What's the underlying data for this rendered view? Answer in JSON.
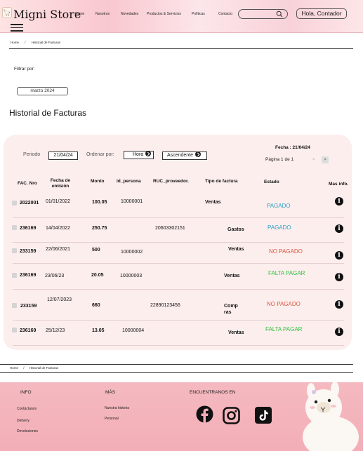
{
  "header": {
    "brand": "Migni Store",
    "nav": [
      "Home",
      "Nosotros",
      "Novedades",
      "Productos & Servicios",
      "Políticas",
      "Contacto"
    ],
    "search_placeholder": "",
    "account_label": "Hola, Contador"
  },
  "breadcrumb": {
    "home": "Home",
    "separator": "/",
    "current": "Historial de Facturas"
  },
  "filter": {
    "label": "Filtrar por:",
    "month": "marzo 2024"
  },
  "page_title": "Historial de Facturas",
  "controls": {
    "period_label": "Periodo",
    "period_value": "21/04/24",
    "order_label": "Ordenar por:",
    "order_value": "Hora",
    "direction_value": "Ascendente",
    "date_label": "Fecha : 21/04/24",
    "page_label": "Página 1 de 1",
    "prev": "<",
    "next": ">"
  },
  "table": {
    "columns": {
      "fac": "FAC. Nro",
      "fecha": "Fecha de emisión",
      "monto": "Monto",
      "persona": "id_persona",
      "ruc": "RUC_proveedor.",
      "tipo": "Tipo de factura",
      "estado": "Estado",
      "info": "Mas info."
    },
    "rows": [
      {
        "fac": "2022001",
        "fecha": "01/01/2022",
        "monto": "100.05",
        "persona": "10000001",
        "ruc": "",
        "tipo": "Ventas",
        "estado": "PAGADO"
      },
      {
        "fac": "236169",
        "fecha": "14/04/2022",
        "monto": "250.75",
        "persona": "",
        "ruc": "20603302151",
        "tipo": "Gastos",
        "estado": "PAGADO"
      },
      {
        "fac": "233159",
        "fecha": "22/06/2021",
        "monto": "500",
        "persona": "10000002",
        "ruc": "",
        "tipo": "Ventas",
        "estado": "NO PAGADO"
      },
      {
        "fac": "236169",
        "fecha": "23/06/23",
        "monto": "20.05",
        "persona": "10000003",
        "ruc": "",
        "tipo": "Ventas",
        "estado": "FALTA PAGAR"
      },
      {
        "fac": "233159",
        "fecha": "12/07/2023",
        "monto": "660",
        "persona": "",
        "ruc": "22890123456",
        "tipo": "Comp ras",
        "estado": "NO PAGADO"
      },
      {
        "fac": "236169",
        "fecha": "25/12/23",
        "monto": "13.05",
        "persona": "10000004",
        "ruc": "",
        "tipo": "Ventas",
        "estado": "FALTA PAGAR"
      }
    ],
    "info_glyph": "i"
  },
  "colors": {
    "pagado": "#2aa0c8",
    "no_pagado": "#d9573c",
    "falta_pagar": "#2ec23a"
  },
  "footer": {
    "info_title": "INFO",
    "info_links": [
      "Contáctanos",
      "Delivery",
      "Devoluciones"
    ],
    "mas_title": "MÁS",
    "mas_links": [
      "Nuestra historia",
      "Personal"
    ],
    "social_title": "ENCUENTRANOS EN",
    "icons": [
      "facebook-icon",
      "instagram-icon",
      "tiktok-icon"
    ]
  }
}
